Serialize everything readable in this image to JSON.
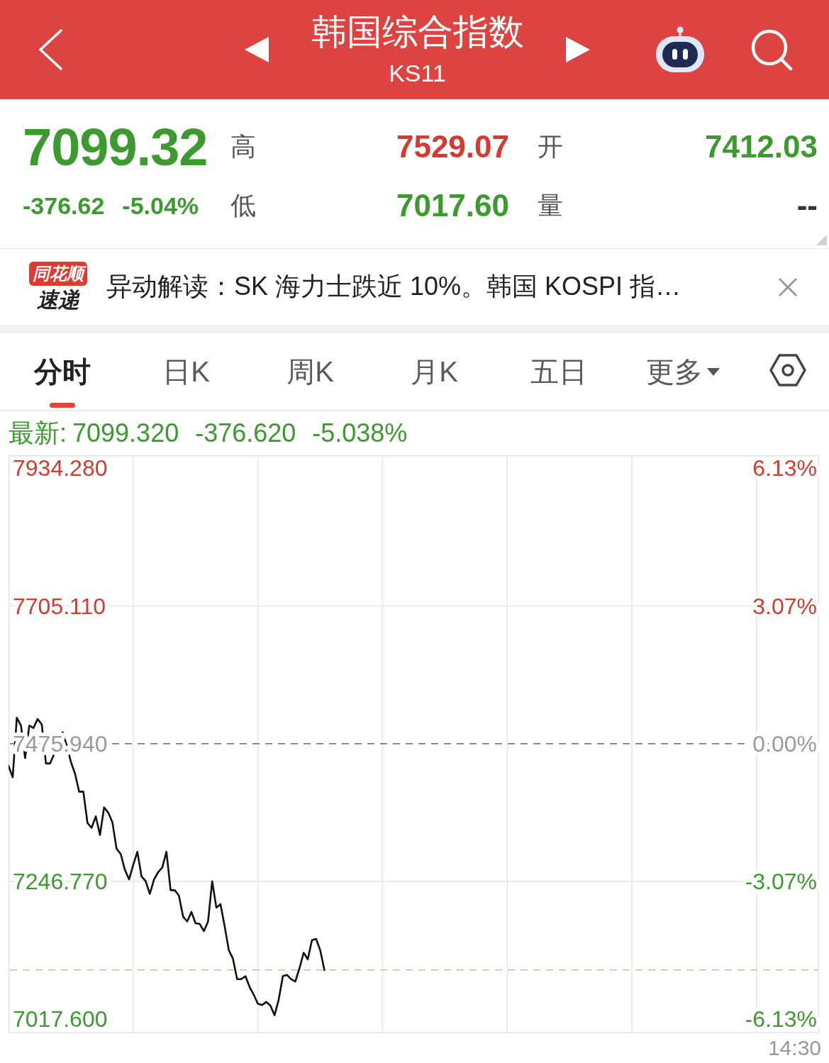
{
  "header": {
    "title": "韩国综合指数",
    "code": "KS11"
  },
  "quote": {
    "price": "7099.32",
    "change": "-376.62",
    "change_percent": "-5.04%",
    "stats": [
      {
        "label": "高",
        "value": "7529.07",
        "color": "#d9382f"
      },
      {
        "label": "开",
        "value": "7412.03",
        "color": "#3d9a2f"
      },
      {
        "label": "低",
        "value": "7017.60",
        "color": "#3d9a2f"
      },
      {
        "label": "量",
        "value": "--",
        "color": "#333333"
      }
    ]
  },
  "news": {
    "logo_top": "同花顺",
    "logo_bottom": "速递",
    "text": "异动解读：SK 海力士跌近 10%。韩国 KOSPI 指…"
  },
  "tabs": [
    {
      "label": "分时",
      "selected": true,
      "kind": "tab"
    },
    {
      "label": "日K",
      "selected": false,
      "kind": "tab"
    },
    {
      "label": "周K",
      "selected": false,
      "kind": "tab"
    },
    {
      "label": "月K",
      "selected": false,
      "kind": "tab"
    },
    {
      "label": "五日",
      "selected": false,
      "kind": "tab"
    },
    {
      "label": "更多",
      "selected": false,
      "kind": "menu"
    }
  ],
  "chart": {
    "latest": {
      "label": "最新:",
      "values": [
        "7099.320",
        "-376.620",
        "-5.038%"
      ]
    },
    "percent_labels": [
      {
        "text": "6.13%",
        "kind": "up"
      },
      {
        "text": "3.07%",
        "kind": "up"
      },
      {
        "text": "0.00%",
        "kind": "flat"
      },
      {
        "text": "-3.07%",
        "kind": "down"
      },
      {
        "text": "-6.13%",
        "kind": "down"
      }
    ],
    "chart_data": {
      "type": "line",
      "ylim": [
        6994,
        7956
      ],
      "yticks": [
        {
          "value": 7934.28,
          "label": "7934.280"
        },
        {
          "value": 7705.11,
          "label": "7705.110"
        },
        {
          "value": 7475.94,
          "label": "7475.940"
        },
        {
          "value": 7246.77,
          "label": "7246.770"
        },
        {
          "value": 7017.6,
          "label": "7017.600"
        }
      ],
      "categories": [
        null,
        null,
        null,
        null,
        null,
        null,
        null,
        null,
        null,
        null,
        null,
        null,
        null,
        null,
        null,
        null,
        null,
        null,
        null,
        null,
        null,
        null,
        null,
        null,
        null,
        null,
        null,
        null,
        null,
        null,
        null,
        null,
        null,
        null,
        null,
        null,
        null,
        null,
        null,
        null,
        null,
        null,
        null,
        null,
        null,
        null,
        null,
        null,
        null,
        null,
        null,
        null,
        null,
        null,
        null,
        null,
        null,
        null,
        null,
        null,
        null,
        null,
        null,
        null,
        null,
        null,
        null,
        null,
        null,
        null,
        null,
        null,
        null,
        null,
        null,
        null,
        null,
        null,
        null,
        null,
        null,
        null,
        null,
        null,
        null,
        null,
        null,
        null,
        null,
        null,
        null,
        null,
        null,
        null,
        null,
        null,
        null,
        null,
        null,
        null,
        null,
        null,
        null,
        null,
        null,
        null,
        null,
        null,
        null,
        null,
        null,
        null,
        null,
        null,
        null,
        null,
        null,
        null,
        null,
        null,
        null,
        null,
        null,
        null,
        null,
        null,
        null,
        null,
        null,
        null,
        null,
        null,
        null,
        null,
        null,
        null,
        null,
        null,
        null,
        null,
        null,
        null,
        null,
        null,
        null,
        null,
        null,
        null,
        null,
        null,
        null,
        null,
        null,
        null,
        null,
        null,
        null,
        null,
        null,
        null,
        null,
        null,
        null,
        null,
        null,
        null,
        null,
        null,
        null,
        null,
        null,
        null,
        null,
        null,
        null,
        null,
        null,
        null,
        null,
        null,
        null,
        null,
        null,
        null,
        null,
        null,
        null,
        null,
        null,
        null,
        null,
        null,
        null,
        null,
        null,
        null
      ],
      "series": [
        {
          "color": "#111111",
          "values": [
            7439,
            7420,
            7519,
            7506,
            7452,
            7506,
            7502,
            7517,
            7508,
            7443,
            7443,
            7459,
            7474,
            7495,
            7473,
            7446,
            7426,
            7396,
            7396,
            7344,
            7336,
            7355,
            7324,
            7370,
            7361,
            7345,
            7301,
            7292,
            7266,
            7250,
            7274,
            7296,
            7255,
            7247,
            7226,
            7250,
            7262,
            7270,
            7296,
            7232,
            7232,
            7223,
            7188,
            7180,
            7196,
            7177,
            7176,
            7164,
            7180,
            7247,
            7203,
            7209,
            7172,
            7132,
            7118,
            7084,
            7084,
            7089,
            7071,
            7058,
            7043,
            7041,
            7046,
            7040,
            7024,
            7050,
            7089,
            7091,
            7084,
            7080,
            7102,
            7128,
            7117,
            7149,
            7151,
            7132,
            7099,
            null,
            null,
            null,
            null,
            null,
            null,
            null,
            null,
            null,
            null,
            null,
            null,
            null,
            null,
            null,
            null,
            null,
            null,
            null,
            null,
            null,
            null,
            null,
            null,
            null,
            null,
            null,
            null,
            null,
            null,
            null,
            null,
            null,
            null,
            null,
            null,
            null,
            null,
            null,
            null,
            null,
            null,
            null,
            null,
            null,
            null,
            null,
            null,
            null,
            null,
            null,
            null,
            null,
            null,
            null,
            null,
            null,
            null,
            null,
            null,
            null,
            null,
            null,
            null,
            null,
            null,
            null,
            null,
            null,
            null,
            null,
            null,
            null,
            null,
            null,
            null,
            null,
            null,
            null,
            null,
            null,
            null,
            null,
            null,
            null,
            null,
            null,
            null,
            null,
            null,
            null,
            null,
            null,
            null,
            null,
            null,
            null,
            null,
            null,
            null,
            null,
            null,
            null,
            null,
            null,
            null,
            null,
            null,
            null,
            null,
            null,
            null,
            null,
            null,
            null,
            null,
            null,
            null,
            null
          ]
        }
      ],
      "ref_lines": [
        {
          "axis": "y",
          "value": 7475.94,
          "color": "#666666"
        },
        {
          "axis": "y",
          "value": 7099.32,
          "color": "#c9c09a"
        }
      ]
    },
    "time_label": "14:30"
  }
}
